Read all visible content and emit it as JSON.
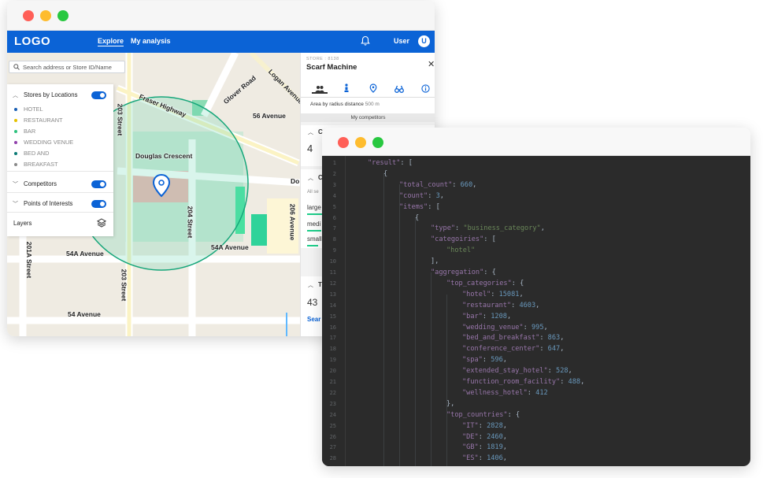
{
  "app_window": {
    "nav": {
      "logo": "LOGO",
      "explore": "Explore",
      "my_analysis": "My analysis",
      "user": "User",
      "avatar_initial": "U"
    },
    "search": {
      "placeholder": "Search address or Store ID/Name"
    },
    "layers_panel": {
      "stores_by_locations": "Stores by Locations",
      "categories": [
        {
          "label": "HOTEL",
          "color": "#1a5fb4"
        },
        {
          "label": "RESTAURANT",
          "color": "#e5c100"
        },
        {
          "label": "BAR",
          "color": "#2ec27e"
        },
        {
          "label": "WEDDING VENUE",
          "color": "#9141ac"
        },
        {
          "label": "BED AND",
          "color": "#0b7a75"
        },
        {
          "label": "BREAKFAST",
          "color": "#8a8a8a"
        }
      ],
      "competitors": "Competitors",
      "points_of_interests": "Points of Interests",
      "layers": "Layers"
    },
    "map_labels": {
      "fraser_highway": "Fraser Highway",
      "glover_road": "Glover Road",
      "logan_avenue": "Logan Avenue",
      "ave_56": "56 Avenue",
      "douglas_crescent": "Douglas Crescent",
      "street_203_top": "203 Street",
      "street_204": "204 Street",
      "street_206": "206 Avenue",
      "ave_54a_left": "54A Avenue",
      "ave_54a_right": "54A Avenue",
      "street_201a": "201A Street",
      "street_203_bottom": "203 Street",
      "ave_54": "54 Avenue",
      "do": "Do"
    },
    "side_panel": {
      "store_label": "STORE : 8138",
      "store_name": "Scarf Machine",
      "radius_label": "Area by radius distance",
      "radius_value": "500 m",
      "my_competitors": "My competitors",
      "card1_letter": "C",
      "card1_value": "4",
      "card2_letter": "C",
      "card2_small": "All se",
      "rows": [
        "large",
        "medi",
        "small"
      ],
      "card3_letter": "T",
      "card3_value": "43",
      "search_link": "Sear"
    }
  },
  "code_window": {
    "lines": [
      "1",
      "2",
      "3",
      "4",
      "5",
      "6",
      "7",
      "8",
      "9",
      "10",
      "11",
      "12",
      "13",
      "14",
      "15",
      "16",
      "17",
      "18",
      "19",
      "20",
      "21",
      "22",
      "23",
      "24",
      "25",
      "26",
      "27",
      "28"
    ],
    "code": {
      "result_key": "\"result\"",
      "total_count_key": "\"total_count\"",
      "total_count_val": "660",
      "count_key": "\"count\"",
      "count_val": "3",
      "items_key": "\"items\"",
      "type_key": "\"type\"",
      "type_val": "\"business_category\"",
      "categoiries_key": "\"categoiries\"",
      "hotel_str": "\"hotel\"",
      "aggregation_key": "\"aggregation\"",
      "top_categories_key": "\"top_categories\"",
      "tc": [
        {
          "k": "\"hotel\"",
          "v": "15081"
        },
        {
          "k": "\"restaurant\"",
          "v": "4603"
        },
        {
          "k": "\"bar\"",
          "v": "1208"
        },
        {
          "k": "\"wedding_venue\"",
          "v": "995"
        },
        {
          "k": "\"bed_and_breakfast\"",
          "v": "863"
        },
        {
          "k": "\"conference_center\"",
          "v": "647"
        },
        {
          "k": "\"spa\"",
          "v": "596"
        },
        {
          "k": "\"extended_stay_hotel\"",
          "v": "528"
        },
        {
          "k": "\"function_room_facility\"",
          "v": "488"
        },
        {
          "k": "\"wellness_hotel\"",
          "v": "412"
        }
      ],
      "top_countries_key": "\"top_countries\"",
      "countries": [
        {
          "k": "\"IT\"",
          "v": "2828"
        },
        {
          "k": "\"DE\"",
          "v": "2460"
        },
        {
          "k": "\"GB\"",
          "v": "1819"
        },
        {
          "k": "\"ES\"",
          "v": "1406"
        }
      ]
    }
  }
}
